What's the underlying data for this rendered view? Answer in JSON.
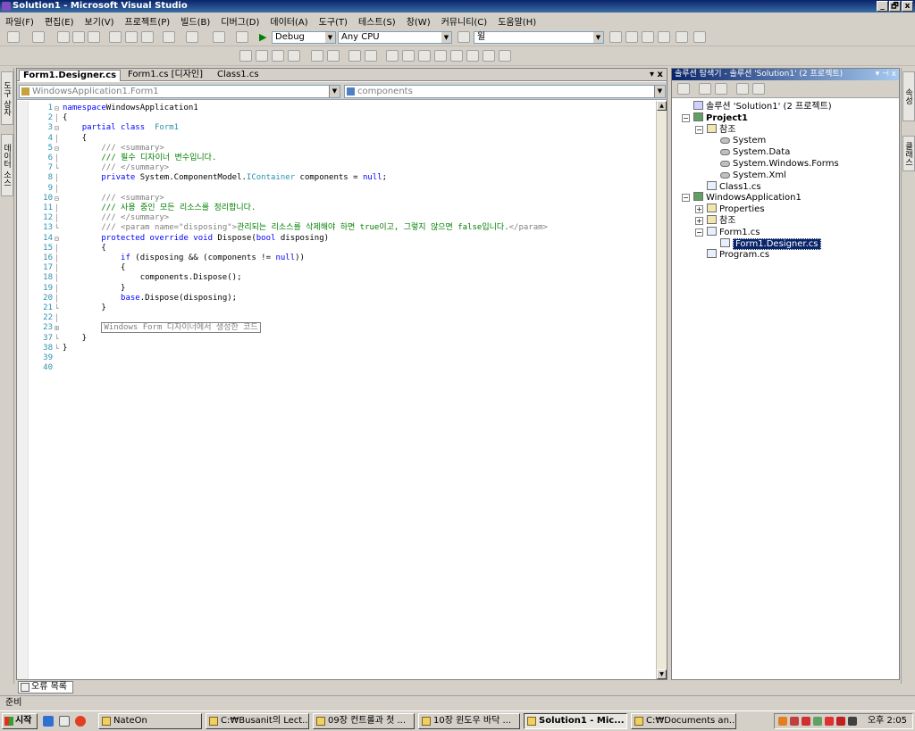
{
  "window": {
    "title": "Solution1 - Microsoft Visual Studio",
    "min": "_",
    "max": "🗗",
    "close": "x"
  },
  "menu": [
    "파일(F)",
    "편집(E)",
    "보기(V)",
    "프로젝트(P)",
    "빌드(B)",
    "디버그(D)",
    "데이터(A)",
    "도구(T)",
    "테스트(S)",
    "창(W)",
    "커뮤니티(C)",
    "도움말(H)"
  ],
  "toolbar": {
    "config": "Debug",
    "platform": "Any CPU",
    "find": "윌"
  },
  "leftbar": {
    "toolbox": "도구 상자",
    "datasources": "데이터 소스"
  },
  "rightbar": {
    "props": "속성",
    "classview": "클래스"
  },
  "editor": {
    "tabs": [
      "Form1.Designer.cs",
      "Form1.cs [디자인]",
      "Class1.cs"
    ],
    "close_label": "▾ x",
    "type_combo": "WindowsApplication1.Form1",
    "member_combo": "components",
    "lines": [
      {
        "n": "1",
        "f": "⊟",
        "t": [
          [
            "kw",
            "namespace"
          ],
          [
            "",
            "WindowsApplication1"
          ]
        ]
      },
      {
        "n": "2",
        "f": "│",
        "t": [
          [
            "",
            "{"
          ]
        ]
      },
      {
        "n": "3",
        "f": "⊟",
        "t": [
          [
            "",
            "    "
          ],
          [
            "kw",
            "partial class"
          ],
          [
            "",
            "  "
          ],
          [
            "ty",
            "Form1"
          ]
        ]
      },
      {
        "n": "4",
        "f": "│",
        "t": [
          [
            "",
            "    {"
          ]
        ]
      },
      {
        "n": "5",
        "f": "⊟",
        "t": [
          [
            "",
            "        "
          ],
          [
            "cg",
            "/// <summary>"
          ]
        ]
      },
      {
        "n": "6",
        "f": "│",
        "t": [
          [
            "",
            "        "
          ],
          [
            "cm",
            "/// 필수 디자이너 변수입니다."
          ]
        ]
      },
      {
        "n": "7",
        "f": "└",
        "t": [
          [
            "",
            "        "
          ],
          [
            "cg",
            "/// </summary>"
          ]
        ]
      },
      {
        "n": "8",
        "f": "│",
        "t": [
          [
            "",
            "        "
          ],
          [
            "kw",
            "private"
          ],
          [
            "",
            " System.ComponentModel."
          ],
          [
            "ty",
            "IContainer"
          ],
          [
            "",
            " components = "
          ],
          [
            "kw",
            "null"
          ],
          [
            "",
            ";"
          ]
        ]
      },
      {
        "n": "9",
        "f": "│",
        "t": [
          [
            "",
            ""
          ]
        ]
      },
      {
        "n": "10",
        "f": "⊟",
        "t": [
          [
            "",
            "        "
          ],
          [
            "cg",
            "/// <summary>"
          ]
        ]
      },
      {
        "n": "11",
        "f": "│",
        "t": [
          [
            "",
            "        "
          ],
          [
            "cm",
            "/// 사용 중인 모든 리소스를 정리합니다."
          ]
        ]
      },
      {
        "n": "12",
        "f": "│",
        "t": [
          [
            "",
            "        "
          ],
          [
            "cg",
            "/// </summary>"
          ]
        ]
      },
      {
        "n": "13",
        "f": "└",
        "t": [
          [
            "",
            "        "
          ],
          [
            "cg",
            "/// <param name=\"disposing\">"
          ],
          [
            "cm",
            "관리되는 리소스를 삭제해야 하면 true이고, 그렇지 않으면 false입니다."
          ],
          [
            "cg",
            "</param>"
          ]
        ]
      },
      {
        "n": "14",
        "f": "⊟",
        "t": [
          [
            "",
            "        "
          ],
          [
            "kw",
            "protected override void"
          ],
          [
            "",
            " Dispose("
          ],
          [
            "kw",
            "bool"
          ],
          [
            "",
            " disposing)"
          ]
        ]
      },
      {
        "n": "15",
        "f": "│",
        "t": [
          [
            "",
            "        {"
          ]
        ]
      },
      {
        "n": "16",
        "f": "│",
        "t": [
          [
            "",
            "            "
          ],
          [
            "kw",
            "if"
          ],
          [
            "",
            " (disposing && (components != "
          ],
          [
            "kw",
            "null"
          ],
          [
            "",
            "))"
          ]
        ]
      },
      {
        "n": "17",
        "f": "│",
        "t": [
          [
            "",
            "            {"
          ]
        ]
      },
      {
        "n": "18",
        "f": "│",
        "t": [
          [
            "",
            "                components.Dispose();"
          ]
        ]
      },
      {
        "n": "19",
        "f": "│",
        "t": [
          [
            "",
            "            }"
          ]
        ]
      },
      {
        "n": "20",
        "f": "│",
        "t": [
          [
            "",
            "            "
          ],
          [
            "kw",
            "base"
          ],
          [
            "",
            ".Dispose(disposing);"
          ]
        ]
      },
      {
        "n": "21",
        "f": "└",
        "t": [
          [
            "",
            "        }"
          ]
        ]
      },
      {
        "n": "22",
        "f": "│",
        "t": [
          [
            "",
            ""
          ]
        ]
      },
      {
        "n": "23",
        "f": "⊞",
        "t": [
          [
            "",
            "        "
          ],
          [
            "box",
            "Windows Form 디자이너에서 생성한 코드"
          ]
        ]
      },
      {
        "n": "37",
        "f": "└",
        "t": [
          [
            "",
            "    }"
          ]
        ]
      },
      {
        "n": "38",
        "f": "└",
        "t": [
          [
            "",
            "}"
          ]
        ]
      },
      {
        "n": "39",
        "f": "",
        "t": [
          [
            "",
            ""
          ]
        ]
      },
      {
        "n": "40",
        "f": "",
        "t": [
          [
            "",
            ""
          ]
        ]
      }
    ]
  },
  "solution_explorer": {
    "title": "솔루션 탐색기 - 솔루션 'Solution1' (2 프로젝트)",
    "pin": "▾ ⊣ x",
    "items": [
      {
        "label": "솔루션 'Solution1' (2 프로젝트)",
        "level": 0,
        "icon": "sln",
        "exp": ""
      },
      {
        "label": "Project1",
        "level": 0,
        "icon": "proj",
        "exp": "−",
        "bold": true
      },
      {
        "label": "참조",
        "level": 1,
        "icon": "folder",
        "exp": "−"
      },
      {
        "label": "System",
        "level": 2,
        "icon": "ref",
        "exp": ""
      },
      {
        "label": "System.Data",
        "level": 2,
        "icon": "ref",
        "exp": ""
      },
      {
        "label": "System.Windows.Forms",
        "level": 2,
        "icon": "ref",
        "exp": ""
      },
      {
        "label": "System.Xml",
        "level": 2,
        "icon": "ref",
        "exp": ""
      },
      {
        "label": "Class1.cs",
        "level": 1,
        "icon": "file",
        "exp": ""
      },
      {
        "label": "WindowsApplication1",
        "level": 0,
        "icon": "proj",
        "exp": "−"
      },
      {
        "label": "Properties",
        "level": 1,
        "icon": "folder",
        "exp": "+"
      },
      {
        "label": "참조",
        "level": 1,
        "icon": "folder",
        "exp": "+"
      },
      {
        "label": "Form1.cs",
        "level": 1,
        "icon": "file",
        "exp": "−"
      },
      {
        "label": "Form1.Designer.cs",
        "level": 2,
        "icon": "file",
        "exp": "",
        "selected": true
      },
      {
        "label": "Program.cs",
        "level": 1,
        "icon": "file",
        "exp": ""
      }
    ]
  },
  "errorlist": "오류 목록",
  "status": "준비",
  "taskbar": {
    "start": "시작",
    "tasks": [
      {
        "label": "NateOn",
        "active": false
      },
      {
        "label": "C:₩Busanit의 Lect...",
        "active": false
      },
      {
        "label": "09장 컨트롤과 첫 ...",
        "active": false
      },
      {
        "label": "10장 윈도우 바닥 ...",
        "active": false
      },
      {
        "label": "Solution1 - Mic...",
        "active": true
      },
      {
        "label": "C:₩Documents an...",
        "active": false
      }
    ],
    "clock": "오후 2:05"
  }
}
